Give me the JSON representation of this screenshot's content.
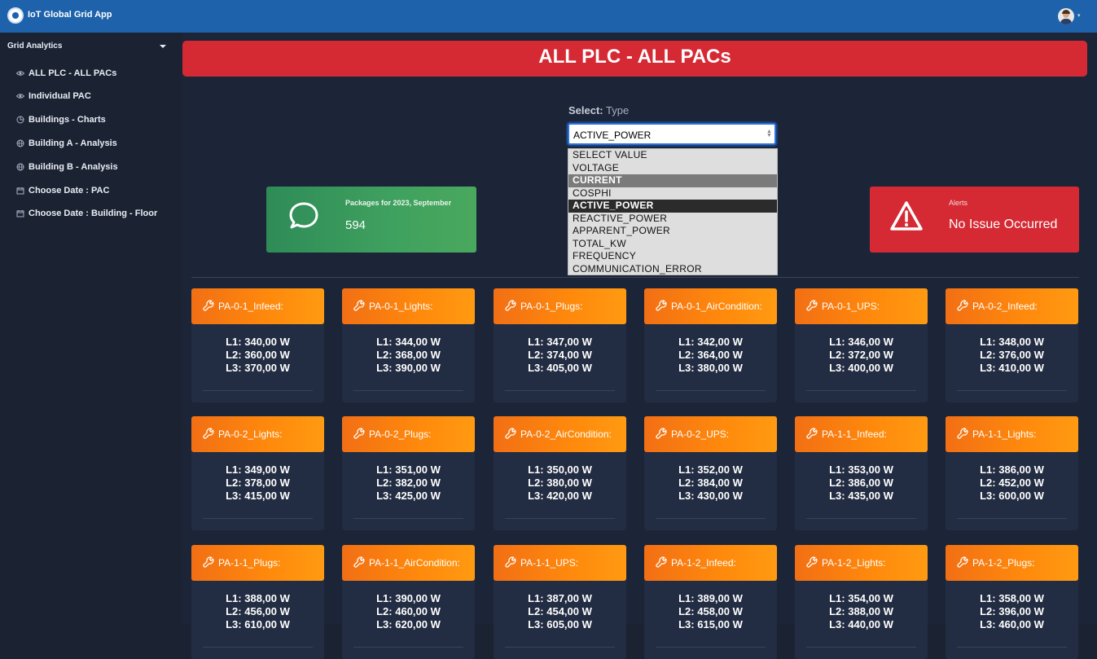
{
  "app": {
    "title": "IoT Global Grid App"
  },
  "sidebar": {
    "header": "Grid Analytics",
    "items": [
      {
        "label": "ALL PLC - ALL PACs",
        "icon": "eye-icon"
      },
      {
        "label": "Individual PAC",
        "icon": "eye-icon"
      },
      {
        "label": "Buildings - Charts",
        "icon": "pie-chart-icon"
      },
      {
        "label": "Building A - Analysis",
        "icon": "globe-icon"
      },
      {
        "label": "Building B - Analysis",
        "icon": "globe-icon"
      },
      {
        "label": "Choose Date : PAC",
        "icon": "calendar-icon"
      },
      {
        "label": "Choose Date : Building - Floor",
        "icon": "calendar-icon"
      }
    ]
  },
  "page": {
    "title": "ALL PLC - ALL PACs"
  },
  "select": {
    "label_bold": "Select:",
    "label_rest": "Type",
    "value": "ACTIVE_POWER",
    "options": [
      "SELECT VALUE",
      "VOLTAGE",
      "CURRENT",
      "COSPHI",
      "ACTIVE_POWER",
      "REACTIVE_POWER",
      "APPARENT_POWER",
      "TOTAL_KW",
      "FREQUENCY",
      "COMMUNICATION_ERROR"
    ],
    "hovered": "CURRENT",
    "selected": "ACTIVE_POWER"
  },
  "packages": {
    "caption": "Packages for 2023, September",
    "value": "594",
    "icon": "chat-bubble-icon",
    "color": "#3fa15f"
  },
  "alerts": {
    "caption": "Alerts",
    "value": "No Issue Occurred",
    "icon": "warning-icon",
    "color": "#d52a34"
  },
  "pacs": [
    {
      "name": "PA-0-1_Infeed:",
      "l1": "340,00 W",
      "l2": "360,00 W",
      "l3": "370,00 W"
    },
    {
      "name": "PA-0-1_Lights:",
      "l1": "344,00 W",
      "l2": "368,00 W",
      "l3": "390,00 W"
    },
    {
      "name": "PA-0-1_Plugs:",
      "l1": "347,00 W",
      "l2": "374,00 W",
      "l3": "405,00 W"
    },
    {
      "name": "PA-0-1_AirCondition:",
      "l1": "342,00 W",
      "l2": "364,00 W",
      "l3": "380,00 W"
    },
    {
      "name": "PA-0-1_UPS:",
      "l1": "346,00 W",
      "l2": "372,00 W",
      "l3": "400,00 W"
    },
    {
      "name": "PA-0-2_Infeed:",
      "l1": "348,00 W",
      "l2": "376,00 W",
      "l3": "410,00 W"
    },
    {
      "name": "PA-0-2_Lights:",
      "l1": "349,00 W",
      "l2": "378,00 W",
      "l3": "415,00 W"
    },
    {
      "name": "PA-0-2_Plugs:",
      "l1": "351,00 W",
      "l2": "382,00 W",
      "l3": "425,00 W"
    },
    {
      "name": "PA-0-2_AirCondition:",
      "l1": "350,00 W",
      "l2": "380,00 W",
      "l3": "420,00 W"
    },
    {
      "name": "PA-0-2_UPS:",
      "l1": "352,00 W",
      "l2": "384,00 W",
      "l3": "430,00 W"
    },
    {
      "name": "PA-1-1_Infeed:",
      "l1": "353,00 W",
      "l2": "386,00 W",
      "l3": "435,00 W"
    },
    {
      "name": "PA-1-1_Lights:",
      "l1": "386,00 W",
      "l2": "452,00 W",
      "l3": "600,00 W"
    },
    {
      "name": "PA-1-1_Plugs:",
      "l1": "388,00 W",
      "l2": "456,00 W",
      "l3": "610,00 W"
    },
    {
      "name": "PA-1-1_AirCondition:",
      "l1": "390,00 W",
      "l2": "460,00 W",
      "l3": "620,00 W"
    },
    {
      "name": "PA-1-1_UPS:",
      "l1": "387,00 W",
      "l2": "454,00 W",
      "l3": "605,00 W"
    },
    {
      "name": "PA-1-2_Infeed:",
      "l1": "389,00 W",
      "l2": "458,00 W",
      "l3": "615,00 W"
    },
    {
      "name": "PA-1-2_Lights:",
      "l1": "354,00 W",
      "l2": "388,00 W",
      "l3": "440,00 W"
    },
    {
      "name": "PA-1-2_Plugs:",
      "l1": "358,00 W",
      "l2": "396,00 W",
      "l3": "460,00 W"
    }
  ]
}
